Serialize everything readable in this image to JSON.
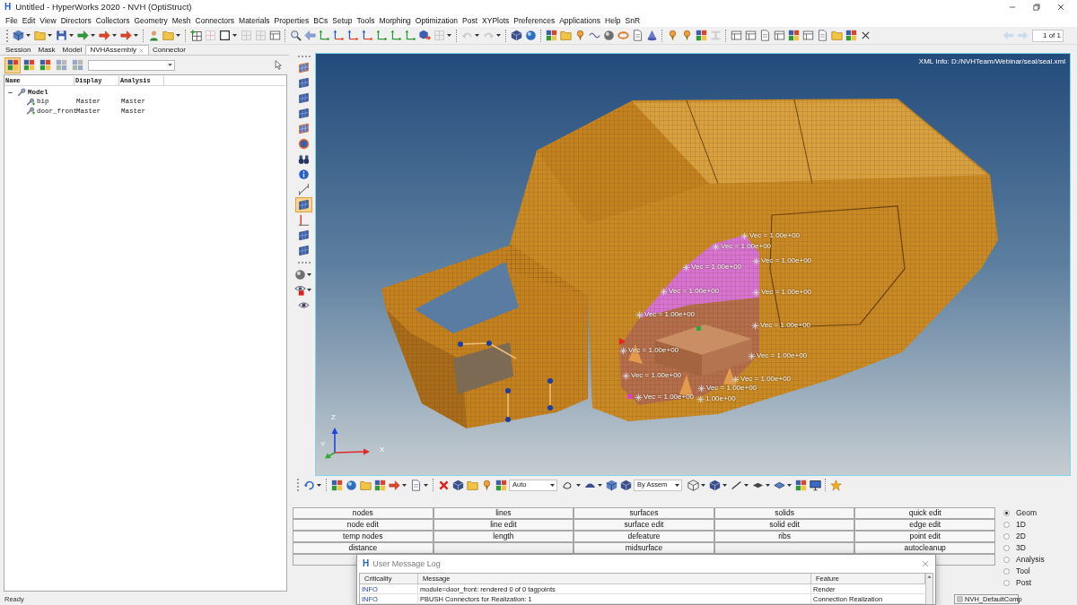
{
  "window": {
    "logo": "H",
    "title": "Untitled - HyperWorks 2020 - NVH (OptiStruct)"
  },
  "menu": [
    "File",
    "Edit",
    "View",
    "Directors",
    "Collectors",
    "Geometry",
    "Mesh",
    "Connectors",
    "Materials",
    "Properties",
    "BCs",
    "Setup",
    "Tools",
    "Morphing",
    "Optimization",
    "Post",
    "XYPlots",
    "Preferences",
    "Applications",
    "Help",
    "SnR"
  ],
  "toolbar": {
    "page_field": {
      "value": "1",
      "total": "of 1"
    }
  },
  "left_panel": {
    "tabs": [
      {
        "label": "Session",
        "selected": false,
        "closable": false
      },
      {
        "label": "Mask",
        "selected": false,
        "closable": false
      },
      {
        "label": "Model",
        "selected": false,
        "closable": false
      },
      {
        "label": "NVHAssembly",
        "selected": true,
        "closable": true
      },
      {
        "label": "Connector",
        "selected": false,
        "closable": false
      }
    ],
    "view_buttons": [
      {
        "selected": true
      },
      {
        "selected": false
      },
      {
        "selected": false
      },
      {
        "selected": false
      },
      {
        "selected": false
      }
    ],
    "tree": {
      "columns": [
        "Name",
        "Display",
        "Analysis"
      ],
      "items": [
        {
          "name": "Model",
          "expanded": true,
          "children": [
            {
              "name": "bip",
              "display": "Master",
              "analysis": "Master"
            },
            {
              "name": "door_front",
              "display": "Master",
              "analysis": "Master"
            }
          ]
        }
      ]
    }
  },
  "side_toolbar": {
    "tools": [
      {
        "selected": false
      },
      {
        "selected": false
      },
      {
        "selected": false
      },
      {
        "selected": false
      },
      {
        "selected": false
      },
      {
        "selected": false
      },
      {
        "selected": false
      },
      {
        "selected": false
      },
      {
        "selected": false
      },
      {
        "selected": true
      },
      {
        "selected": false
      },
      {
        "selected": false
      },
      {
        "selected": false
      },
      {
        "selected": false
      },
      {
        "selected": false
      },
      {
        "selected": false
      }
    ]
  },
  "viewport": {
    "xml_info": "XML Info: D:/NVHTeam/Webinar/seal/seal.xml",
    "vector_labels": [
      "Vec = 1.00e+00",
      "Vec = 1.00e+00",
      "Vec = 1.00e+00",
      "Vec = 1.00e+00",
      "Vec = 1.00e+00",
      "Vec = 1.00e+00",
      "Vec = 1.00e+00",
      "Vec = 1.00e+00",
      "Vec = 1.00e+00",
      "Vec = 1.00e+00",
      "Vec = 1.00e+00",
      "Vec = 1.00e+00",
      "Vec = 1.00e+00",
      "Vec = 1.00e+00",
      "1.00e+00"
    ],
    "axis_labels": [
      "Z",
      "Y",
      "X"
    ]
  },
  "bottom_toolbar": {
    "dropdowns": [
      {
        "value": "Auto"
      },
      {
        "value": "By Assem"
      }
    ]
  },
  "panel": {
    "columns": [
      [
        "nodes",
        "node edit",
        "temp nodes",
        "distance"
      ],
      [
        "lines",
        "line edit",
        "length"
      ],
      [
        "surfaces",
        "surface edit",
        "defeature",
        "midsurface"
      ],
      [
        "solids",
        "solid edit",
        "ribs"
      ],
      [
        "quick edit",
        "edge edit",
        "point edit",
        "autocleanup"
      ]
    ],
    "modes": [
      {
        "label": "Geom",
        "selected": true
      },
      {
        "label": "1D",
        "selected": false
      },
      {
        "label": "2D",
        "selected": false
      },
      {
        "label": "3D",
        "selected": false
      },
      {
        "label": "Analysis",
        "selected": false
      },
      {
        "label": "Tool",
        "selected": false
      },
      {
        "label": "Post",
        "selected": false
      }
    ]
  },
  "message_log": {
    "logo": "H",
    "title": "User Message Log",
    "columns": [
      "Criticality",
      "Message",
      "Feature"
    ],
    "rows": [
      {
        "criticality": "INFO",
        "message": "module=door_front: rendered 0 of 0 tagpoints",
        "feature": "Render"
      },
      {
        "criticality": "INFO",
        "message": "PBUSH Connectors for Realization: 1",
        "feature": "Connection Realization"
      }
    ]
  },
  "status_bar": {
    "text": "Ready",
    "component": "NVH_DefaultComp"
  }
}
